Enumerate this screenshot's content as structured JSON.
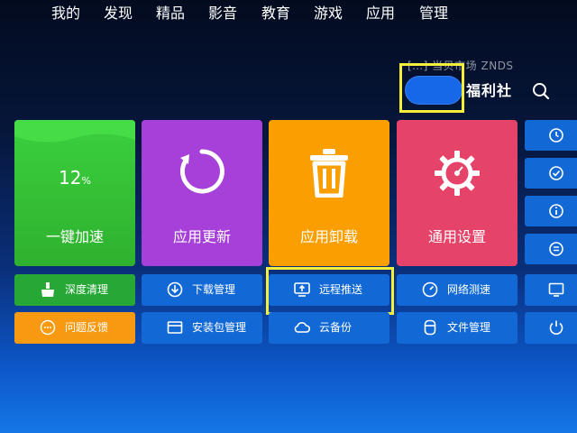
{
  "watermark": "[…] 当贝市场 ZNDS",
  "nav": {
    "items": [
      "我的",
      "发现",
      "精品",
      "影音",
      "教育",
      "游戏",
      "应用",
      "管理"
    ],
    "active": "管理",
    "brand": "福利社"
  },
  "tiles": [
    {
      "label": "一键加速",
      "value": "12",
      "unit": "%",
      "color": "#35c137"
    },
    {
      "label": "应用更新",
      "color": "#a640d8"
    },
    {
      "label": "应用卸载",
      "color": "#fb9f00"
    },
    {
      "label": "通用设置",
      "color": "#e6436a"
    }
  ],
  "buttons_row1": [
    {
      "label": "深度清理",
      "icon": "broom-icon"
    },
    {
      "label": "下载管理",
      "icon": "download-icon"
    },
    {
      "label": "远程推送",
      "icon": "remote-push-icon"
    },
    {
      "label": "网络测速",
      "icon": "speed-gauge-icon"
    }
  ],
  "buttons_row2": [
    {
      "label": "问题反馈",
      "icon": "feedback-icon"
    },
    {
      "label": "安装包管理",
      "icon": "folder-icon"
    },
    {
      "label": "云备份",
      "icon": "cloud-icon"
    },
    {
      "label": "文件管理",
      "icon": "file-icon"
    }
  ],
  "right_column_icons": [
    "timer-icon",
    "check-icon",
    "info-icon",
    "list-icon",
    "dns-icon",
    "power-icon"
  ],
  "colors": {
    "highlight": "#f3ef3a",
    "active_tab": "#1668e8",
    "button_blue": "#1269d6"
  }
}
